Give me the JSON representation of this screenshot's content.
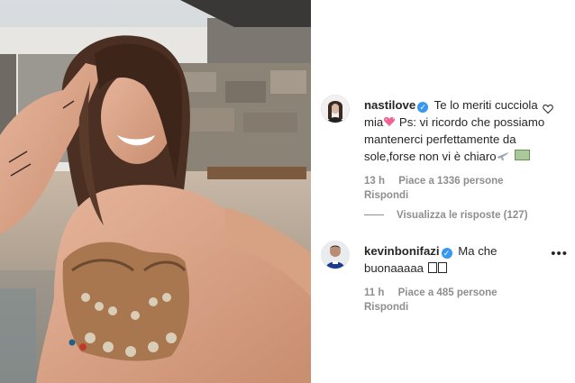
{
  "comments": [
    {
      "username": "nastilove",
      "text": "Te lo meriti cucciola mia",
      "text_after_emoji": " Ps: vi ricordo che possiamo mantenerci perfettamente da sole,forse non vi è chiaro",
      "time": "13 h",
      "likes": "Piace a 1336 persone",
      "reply": "Rispondi",
      "view_replies": "Visualizza le risposte (127)",
      "emoji_icons": [
        "sparkling-heart-icon",
        "airplane-icon",
        "money-icon"
      ]
    },
    {
      "username": "kevinbonifazi",
      "text": "Ma che buonaaaaa",
      "time": "11 h",
      "likes": "Piace a 485 persone",
      "reply": "Rispondi",
      "more": "•••",
      "emoji_icons": [
        "unrendered-glyph-icon",
        "unrendered-glyph-icon"
      ]
    }
  ],
  "colors": {
    "verified": "#3897f0",
    "meta_text": "#8e8e8e",
    "text": "#262626"
  }
}
